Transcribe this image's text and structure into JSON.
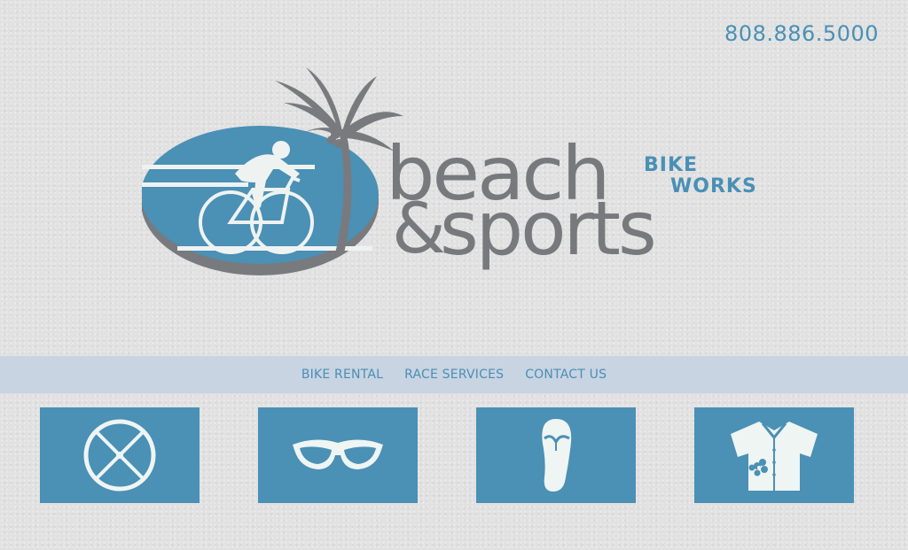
{
  "header": {
    "phone": "808.886.5000"
  },
  "logo": {
    "word_beach": "beach",
    "word_amp": "&",
    "word_sports": "sports",
    "word_bike": "BIKE",
    "word_works": "WORKS"
  },
  "nav": {
    "items": [
      {
        "label": "BIKE RENTAL"
      },
      {
        "label": "RACE SERVICES"
      },
      {
        "label": "CONTACT US"
      }
    ]
  },
  "tiles": [
    {
      "icon": "bike-wheel-icon"
    },
    {
      "icon": "sunglasses-icon"
    },
    {
      "icon": "flip-flop-icon"
    },
    {
      "icon": "hawaiian-shirt-icon"
    }
  ],
  "colors": {
    "background": "#e1e1e1",
    "accent_blue": "#4b90b5",
    "nav_bar": "#c8d4e1",
    "logo_gray": "#77797c",
    "icon_fill": "#eef5f3"
  }
}
